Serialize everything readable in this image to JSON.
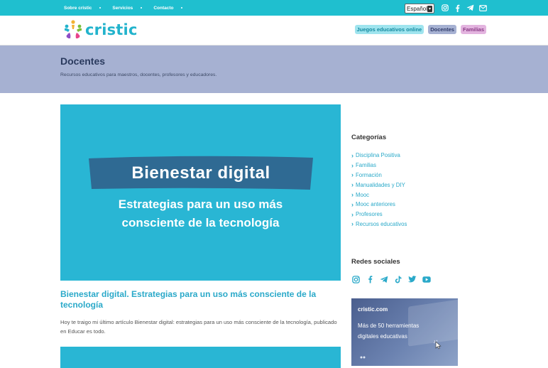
{
  "topbar": {
    "nav": [
      "Sobre cristic",
      "Servicios",
      "Contacto"
    ],
    "language": "Español",
    "icons": [
      "instagram-icon",
      "facebook-icon",
      "telegram-icon",
      "mail-icon"
    ]
  },
  "header": {
    "logo_text": "cristic",
    "nav": {
      "juegos": "Juegos educativos online",
      "docentes": "Docentes",
      "familias": "Familias"
    }
  },
  "hero": {
    "title": "Docentes",
    "subtitle": "Recursos educativos para maestros, docentes, profesores y educadores."
  },
  "post": {
    "image_banner": "Bienestar digital",
    "image_line1": "Estrategias para un uso más",
    "image_line2": "consciente de la tecnología",
    "title": "Bienestar digital. Estrategias para un uso más consciente de la tecnología",
    "excerpt": "Hoy te traigo mi último artículo Bienestar digital: estrategias para un uso más consciente de la tecnología, publicado en Educar es todo."
  },
  "sidebar": {
    "categories_title": "Categorías",
    "categories": [
      "Disciplina Positiva",
      "Familias",
      "Formación",
      "Manualidades y DIY",
      "Mooc",
      "Mooc anteriores",
      "Profesores",
      "Recursos educativos"
    ],
    "social_title": "Redes sociales",
    "social_icons": [
      "instagram-icon",
      "facebook-icon",
      "telegram-icon",
      "tiktok-icon",
      "twitter-icon",
      "youtube-icon"
    ],
    "promo": {
      "brand": "cristic.com",
      "line1": "Más de 50 herramientas",
      "line2": "digitales educativas"
    }
  },
  "colors": {
    "topbar": "#1fbfcf",
    "hero": "#a6b1d2",
    "accent": "#2aa9c9",
    "banner": "#2f6a93"
  }
}
